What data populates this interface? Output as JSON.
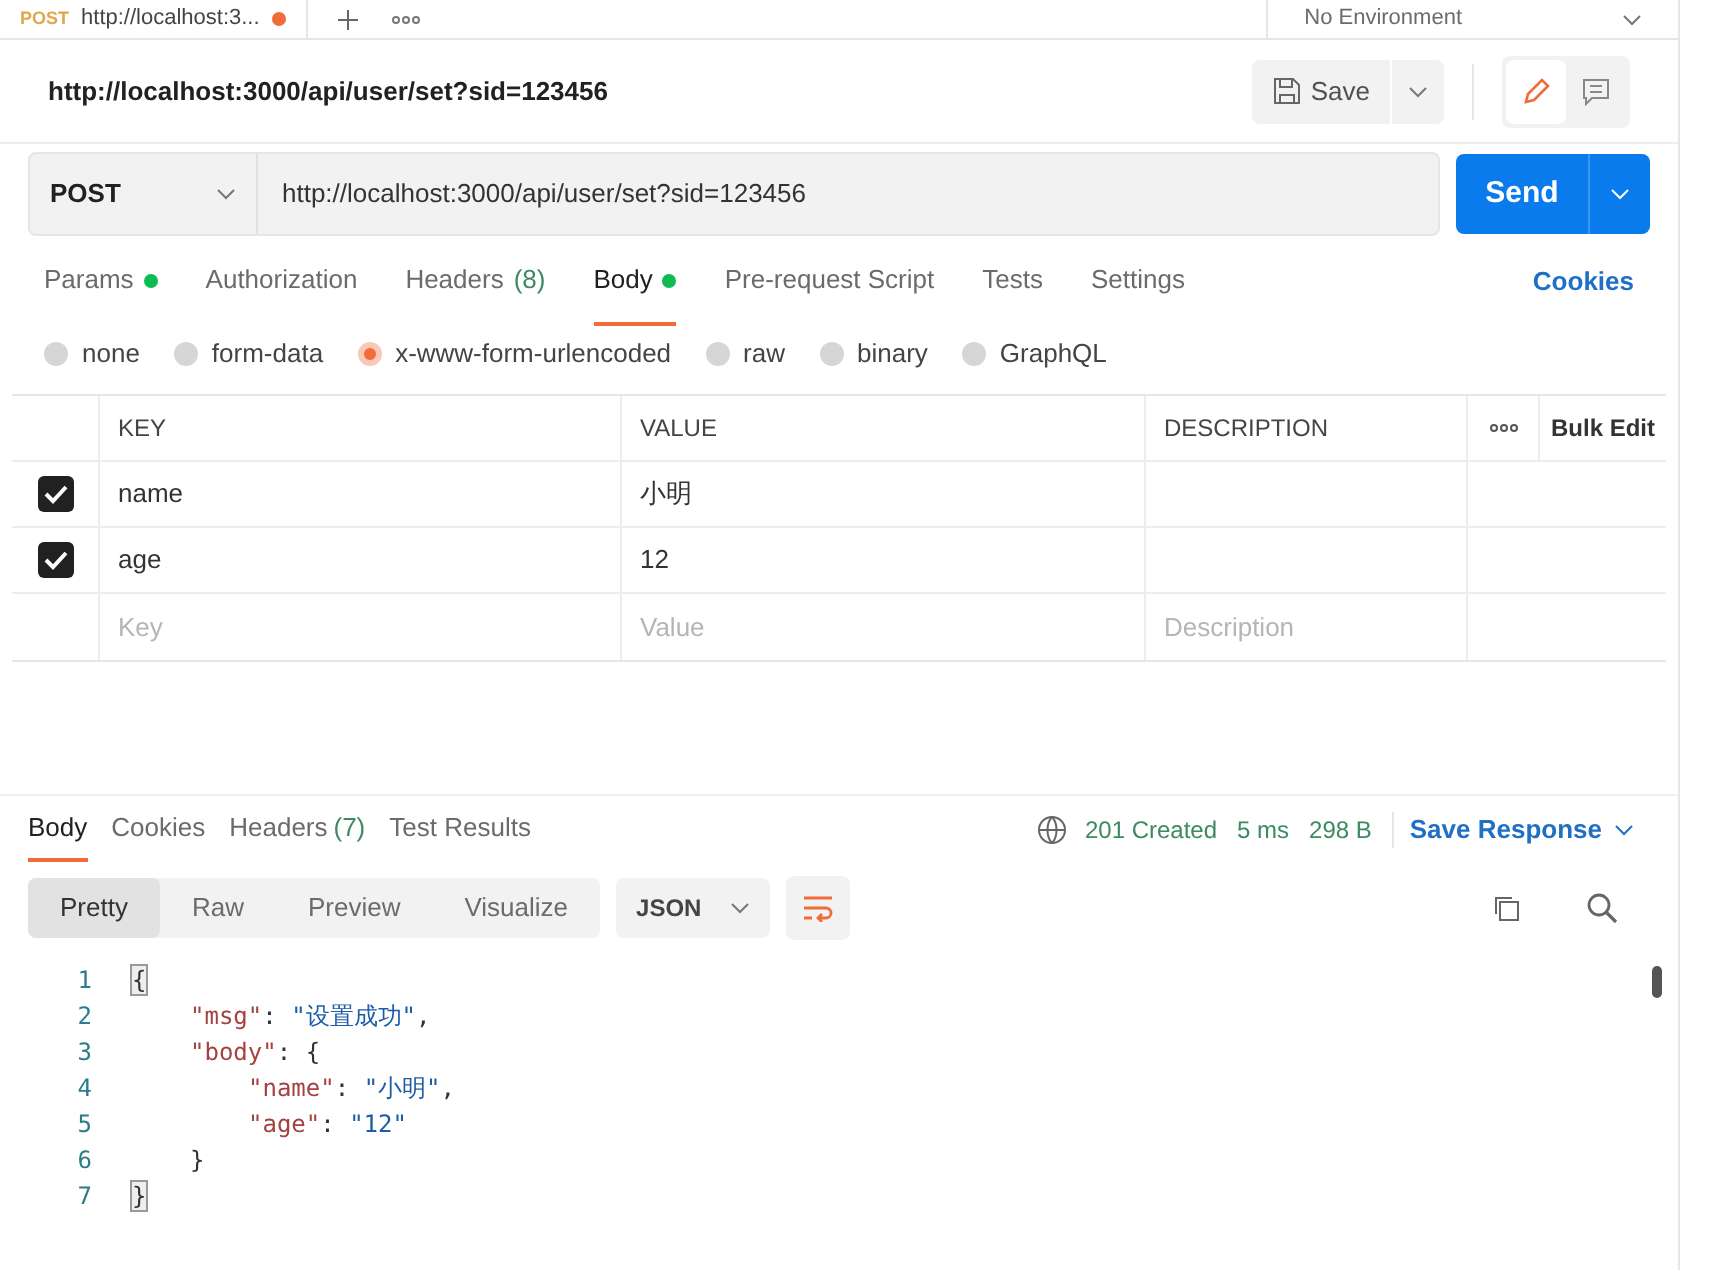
{
  "top_tabs": [
    {
      "method": "POST",
      "title": "http://localhost:3...",
      "unsaved": true,
      "selected": true
    }
  ],
  "environment": "No Environment",
  "request": {
    "title": "http://localhost:3000/api/user/set?sid=123456",
    "save": "Save",
    "method": "POST",
    "url": "http://localhost:3000/api/user/set?sid=123456",
    "send": "Send"
  },
  "request_tabs": [
    {
      "label": "Params",
      "dot": true,
      "selected": false
    },
    {
      "label": "Authorization",
      "dot": false,
      "selected": false
    },
    {
      "label": "Headers",
      "count": "(8)",
      "dot": false,
      "selected": false
    },
    {
      "label": "Body",
      "dot": true,
      "selected": true
    },
    {
      "label": "Pre-request Script",
      "dot": false,
      "selected": false
    },
    {
      "label": "Tests",
      "dot": false,
      "selected": false
    },
    {
      "label": "Settings",
      "dot": false,
      "selected": false
    }
  ],
  "cookies": "Cookies",
  "body_types": [
    {
      "label": "none",
      "selected": false
    },
    {
      "label": "form-data",
      "selected": false
    },
    {
      "label": "x-www-form-urlencoded",
      "selected": true
    },
    {
      "label": "raw",
      "selected": false
    },
    {
      "label": "binary",
      "selected": false
    },
    {
      "label": "GraphQL",
      "selected": false
    }
  ],
  "params_table": {
    "columns": [
      "KEY",
      "VALUE",
      "DESCRIPTION"
    ],
    "bulk_edit": "Bulk Edit",
    "rows": [
      {
        "checked": true,
        "key": "name",
        "value": "小明"
      },
      {
        "checked": true,
        "key": "age",
        "value": "12"
      }
    ],
    "new_row": {
      "key_placeholder": "Key",
      "value_placeholder": "Value",
      "description_placeholder": "Description"
    }
  },
  "response_tabs": [
    {
      "label": "Body",
      "selected": true
    },
    {
      "label": "Cookies",
      "selected": false
    },
    {
      "label": "Headers",
      "count": "(7)",
      "selected": false
    },
    {
      "label": "Test Results",
      "selected": false
    }
  ],
  "status": "201 Created",
  "time": "5 ms",
  "size": "298 B",
  "save_response": "Save Response",
  "view_modes": [
    {
      "label": "Pretty",
      "selected": true
    },
    {
      "label": "Raw",
      "selected": false
    },
    {
      "label": "Preview",
      "selected": false
    },
    {
      "label": "Visualize",
      "selected": false
    }
  ],
  "format": "JSON",
  "code_lines": [
    {
      "number": "1",
      "tokens": [
        {
          "kind": "open",
          "text": "{",
          "matched": true
        }
      ]
    },
    {
      "number": "2",
      "tokens": [
        {
          "kind": "key",
          "text": "\"msg\""
        },
        {
          "kind": "punct",
          "text": ": "
        },
        {
          "kind": "string",
          "text": "\"设置成功\""
        },
        {
          "kind": "punct",
          "text": ","
        }
      ]
    },
    {
      "number": "3",
      "tokens": [
        {
          "kind": "key",
          "text": "\"body\""
        },
        {
          "kind": "punct",
          "text": ": "
        },
        {
          "kind": "open",
          "text": "{",
          "matched": false
        }
      ]
    },
    {
      "number": "4",
      "tokens": [
        {
          "kind": "key",
          "text": "\"name\""
        },
        {
          "kind": "punct",
          "text": ": "
        },
        {
          "kind": "string",
          "text": "\"小明\""
        },
        {
          "kind": "punct",
          "text": ","
        }
      ]
    },
    {
      "number": "5",
      "tokens": [
        {
          "kind": "key",
          "text": "\"age\""
        },
        {
          "kind": "punct",
          "text": ": "
        },
        {
          "kind": "string",
          "text": "\"12\""
        }
      ]
    },
    {
      "number": "6",
      "tokens": [
        {
          "kind": "close",
          "text": "}",
          "matched": false
        }
      ]
    },
    {
      "number": "7",
      "tokens": [
        {
          "kind": "close",
          "text": "}",
          "matched": true
        }
      ]
    }
  ]
}
